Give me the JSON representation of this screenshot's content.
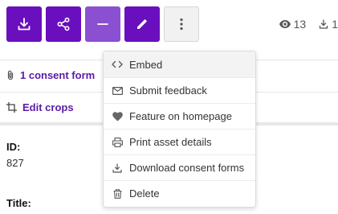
{
  "toolbar": {
    "buttons": [
      {
        "icon": "download-icon"
      },
      {
        "icon": "share-icon"
      },
      {
        "icon": "minus-icon"
      },
      {
        "icon": "pencil-icon"
      },
      {
        "icon": "more-vertical-icon"
      }
    ]
  },
  "stats": {
    "views": "13",
    "downloads": "1"
  },
  "links": {
    "consent_form": "1 consent form",
    "edit_crops": "Edit crops"
  },
  "fields": {
    "id_label": "ID:",
    "id_value": "827",
    "title_label": "Title:"
  },
  "menu": {
    "items": [
      {
        "label": "Embed",
        "icon": "code-icon"
      },
      {
        "label": "Submit feedback",
        "icon": "mail-icon"
      },
      {
        "label": "Feature on homepage",
        "icon": "heart-icon"
      },
      {
        "label": "Print asset details",
        "icon": "printer-icon"
      },
      {
        "label": "Download consent forms",
        "icon": "download-icon"
      },
      {
        "label": "Delete",
        "icon": "trash-icon"
      }
    ]
  },
  "colors": {
    "primary": "#6a0fbd",
    "primary_light": "#8b4fd2",
    "link": "#5a1aa8"
  }
}
